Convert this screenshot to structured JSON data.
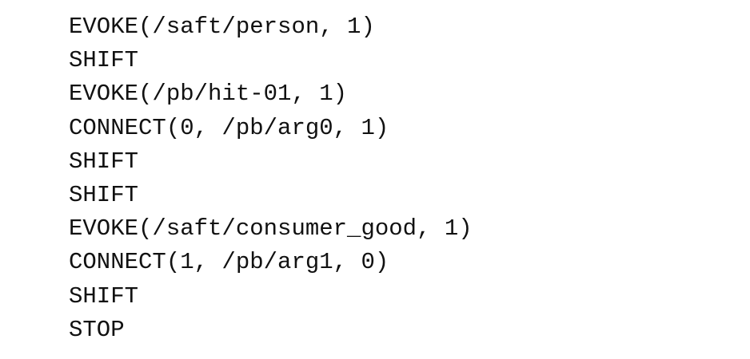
{
  "code_listing": {
    "lines": [
      "EVOKE(/saft/person, 1)",
      "SHIFT",
      "EVOKE(/pb/hit-01, 1)",
      "CONNECT(0, /pb/arg0, 1)",
      "SHIFT",
      "SHIFT",
      "EVOKE(/saft/consumer_good, 1)",
      "CONNECT(1, /pb/arg1, 0)",
      "SHIFT",
      "STOP"
    ]
  }
}
